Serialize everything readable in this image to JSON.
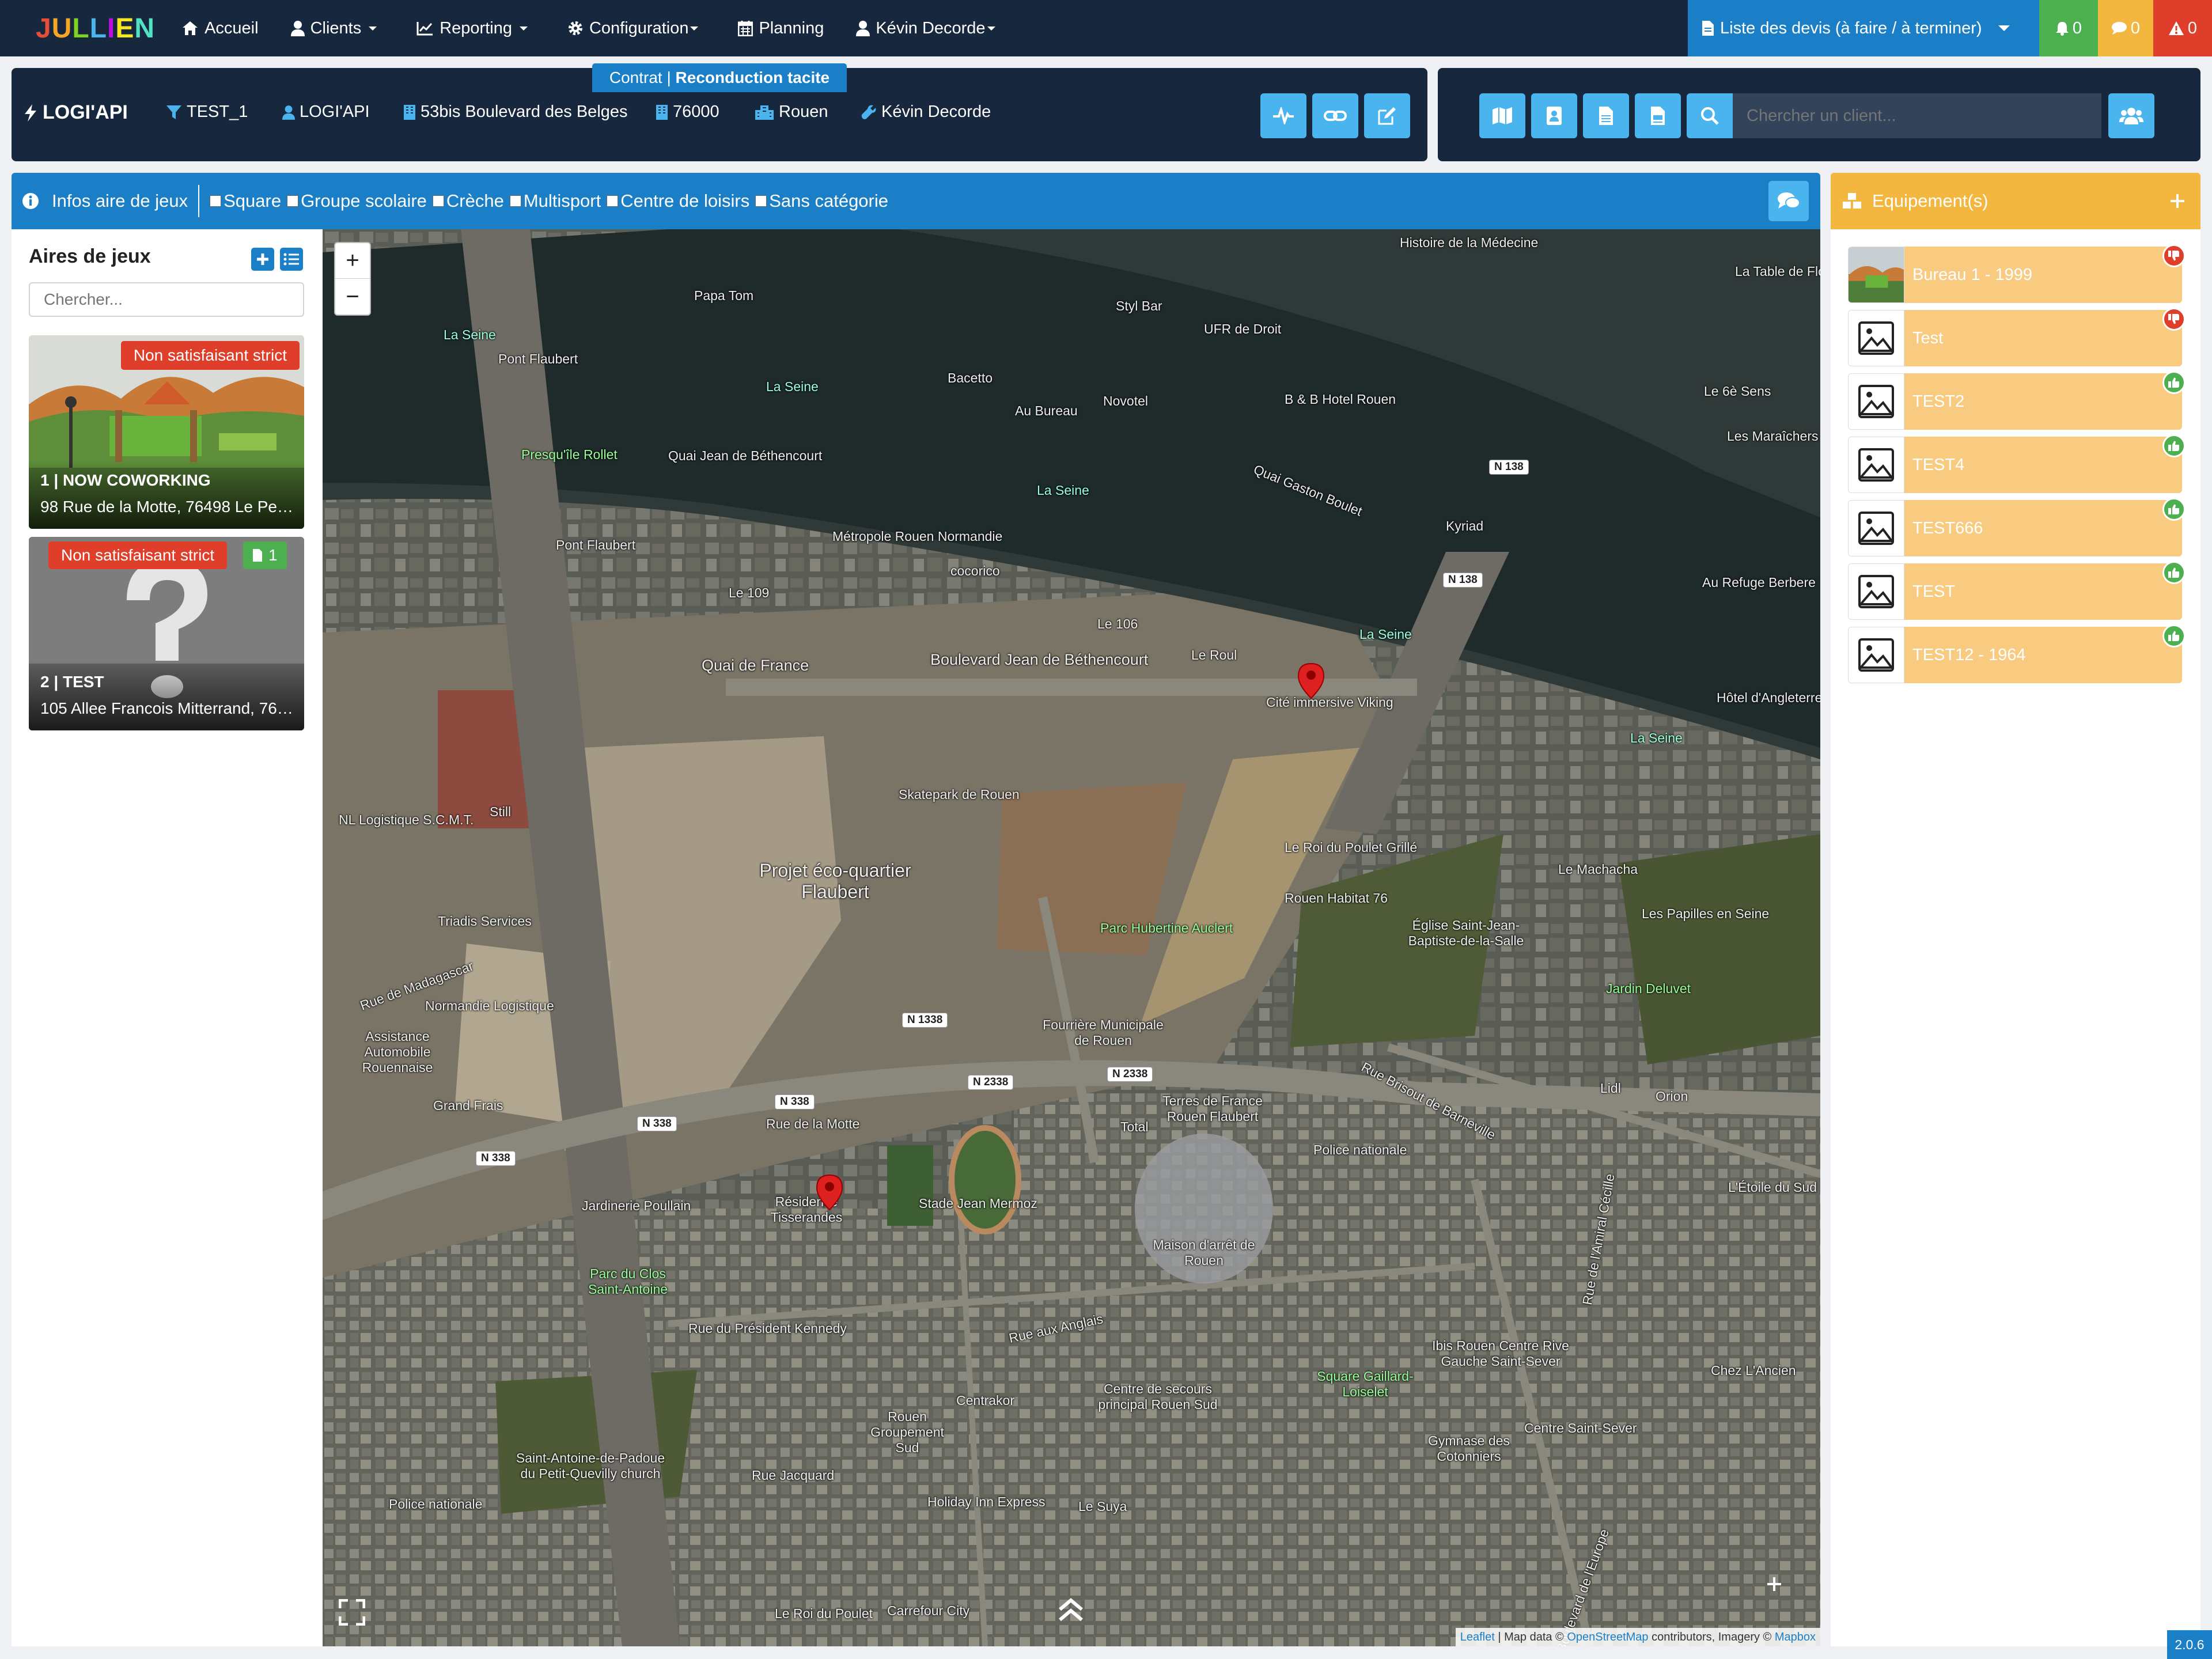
{
  "nav": {
    "brand": "JULLIEN",
    "items": [
      "Accueil",
      "Clients",
      "Reporting",
      "Configuration",
      "Planning",
      "Kévin Decorde"
    ],
    "quotes_dropdown": "Liste des devis (à faire / à terminer)",
    "bell_count": "0",
    "chat_count": "0",
    "alert_count": "0"
  },
  "client": {
    "contract_prefix": "Contrat |",
    "contract_type": "Reconduction tacite",
    "logo": "LOGI'API",
    "name": "TEST_1",
    "company": "LOGI'API",
    "address": "53bis Boulevard des Belges",
    "postal_code": "76000",
    "city": "Rouen",
    "technician": "Kévin Decorde"
  },
  "search": {
    "placeholder": "Chercher un client..."
  },
  "filters": {
    "title": "Infos aire de jeux",
    "options": [
      "Square",
      "Groupe scolaire",
      "Crèche",
      "Multisport",
      "Centre de loisirs",
      "Sans catégorie"
    ]
  },
  "sidebar": {
    "title": "Aires de jeux",
    "search_placeholder": "Chercher...",
    "sites": [
      {
        "status": "Non satisfaisant strict",
        "title": "1 | NOW COWORKING",
        "address": "98 Rue de la Motte, 76498 Le Petit-Quevilly"
      },
      {
        "status": "Non satisfaisant strict",
        "doc_count": "1",
        "title": "2 | TEST",
        "address": "105 Allee Francois Mitterrand, 76100 Rouen"
      }
    ]
  },
  "map": {
    "labels": [
      "La Seine",
      "La Seine",
      "La Seine",
      "La Seine",
      "La Seine",
      "Pont Flaubert",
      "Pont Flaubert",
      "Presqu'île Rollet",
      "Quai Jean de Béthencourt",
      "Métropole Rouen Normandie",
      "cocorico",
      "Le 109",
      "Le 106",
      "Quai de France",
      "Boulevard Jean de Béthencourt",
      "Le Roul",
      "Cité immersive Viking",
      "Skatepark de Rouen",
      "Projet éco-quartier Flaubert",
      "Parc Hubertine Auclert",
      "Le Roi du Poulet Grillé",
      "Rouen Habitat 76",
      "Église Saint-Jean-Baptiste-de-la-Salle",
      "Jardin Deluvet",
      "Fourrière Municipale de Rouen",
      "Terres de France Rouen Flaubert",
      "Total",
      "Stade Jean Mermoz",
      "Résidence Tisserandes",
      "Jardinerie Poullain",
      "Parc du Clos Saint-Antoine",
      "Maison d'arrêt de Rouen",
      "Rue du Président Kennedy",
      "Rue de la Motte",
      "Centre de secours principal Rouen Sud",
      "Centrakor",
      "Rouen Groupement Sud",
      "Square Gaillard-Loiselet",
      "Ibis Rouen Centre Rive Gauche Saint-Sever",
      "Centre Saint-Sever",
      "Gymnase des Cotonniers",
      "Saint-Antoine-de-Padoue du Petit-Quevilly church",
      "Police nationale",
      "Police nationale",
      "Holiday Inn Express",
      "Le Suya",
      "Lidl",
      "Orion",
      "Bacetto",
      "Au Bureau",
      "Novotel",
      "UFR de Droit",
      "B & B Hotel Rouen",
      "Styl Bar",
      "Kyriad",
      "Le Machacha",
      "Les Papilles en Seine",
      "L'Étoile du Sud",
      "Chez L'Ancien",
      "Hôtel d'Angleterre",
      "Au Refuge Berbere",
      "Les Maraîchers",
      "Le 6è Sens",
      "La Table de Flore",
      "Histoire de la Médecine",
      "Grand Frais",
      "Still",
      "NL Logistique S.C.M.T.",
      "Triadis Services",
      "Normandie Logistique",
      "Assistance Automobile Rouennaise",
      "Papa Tom",
      "Rue de Madagascar",
      "Rue Brisout de Barneville",
      "Rue de l'Amiral Cécille",
      "Boulevard de l'Europe",
      "Rue aux Anglais",
      "Rue Jacquard",
      "Quai Gaston Boulet",
      "Carrefour City",
      "Le Roi du Poulet"
    ],
    "shields": [
      "N 138",
      "N 138",
      "N 1338",
      "N 338",
      "N 338",
      "N 338",
      "N 2338",
      "N 2338"
    ],
    "zoom_in": "+",
    "zoom_out": "−",
    "attribution_leaflet": "Leaflet",
    "attribution_text1": "| Map data ©",
    "attribution_osm": "OpenStreetMap",
    "attribution_text2": "contributors, Imagery ©",
    "attribution_mapbox": "Mapbox"
  },
  "equipment": {
    "title": "Equipement(s)",
    "items": [
      {
        "name": "Bureau 1 - 1999",
        "status": "bad"
      },
      {
        "name": "Test",
        "status": "bad"
      },
      {
        "name": "TEST2",
        "status": "good"
      },
      {
        "name": "TEST4",
        "status": "good"
      },
      {
        "name": "TEST666",
        "status": "good"
      },
      {
        "name": "TEST",
        "status": "good"
      },
      {
        "name": "TEST12 - 1964",
        "status": "good"
      }
    ]
  },
  "version": "2.0.6",
  "colors": {
    "nav_bg": "#17273d",
    "primary": "#1b7fc8",
    "accent": "#4ab4ee",
    "warning": "#f3b73f",
    "danger": "#df3e2b",
    "success": "#4caf50"
  }
}
